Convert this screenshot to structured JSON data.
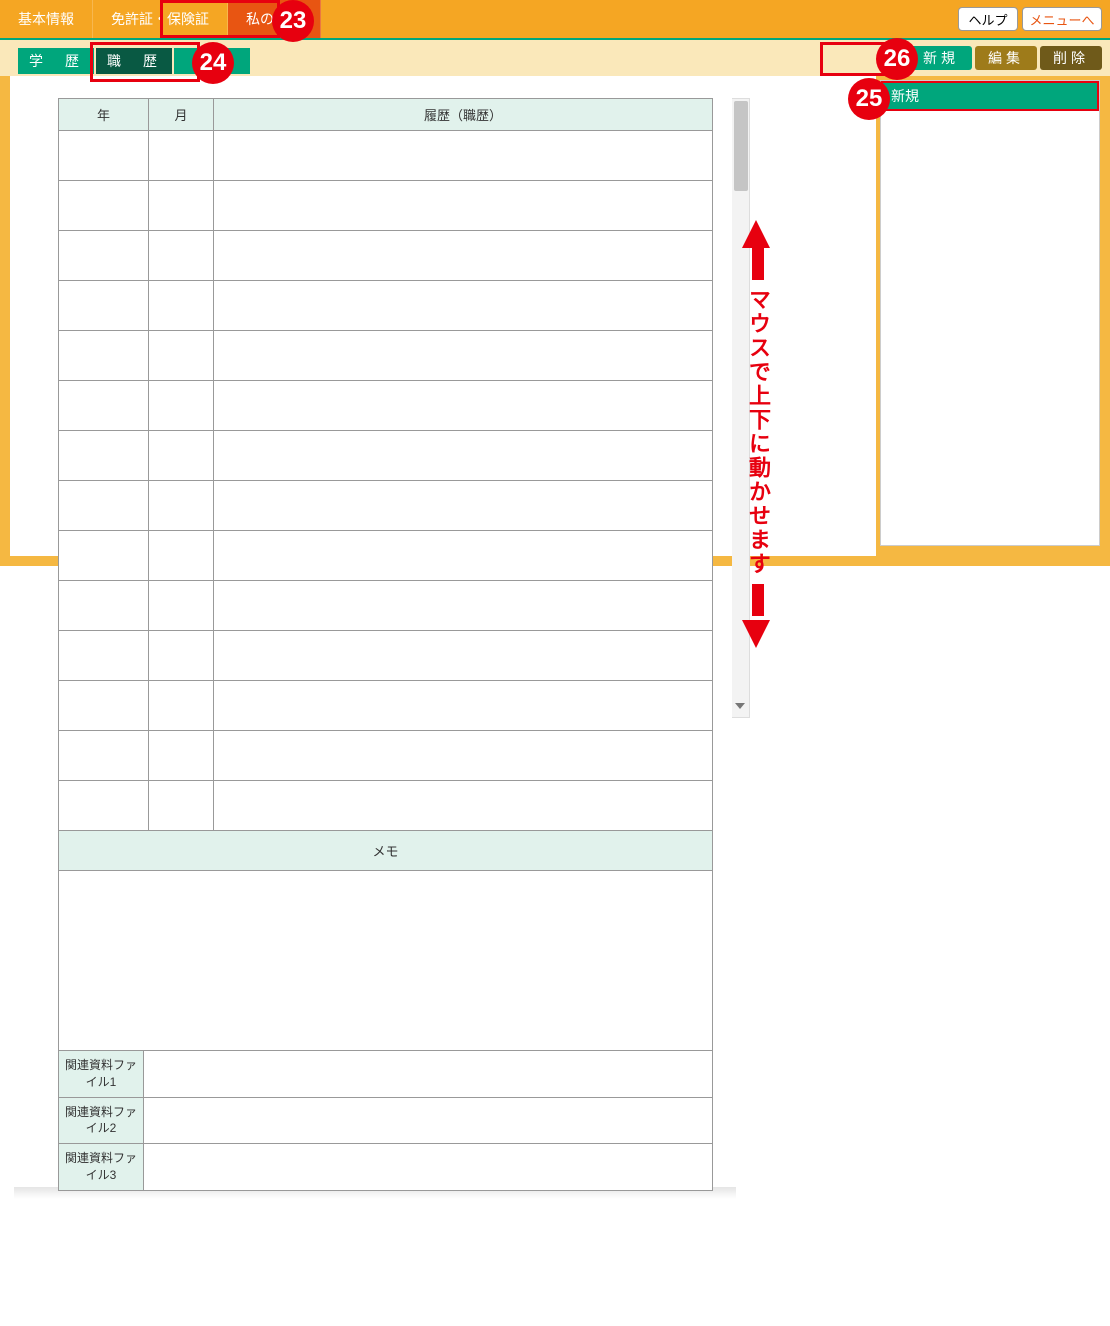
{
  "header": {
    "main_tabs": [
      "基本情報",
      "免許証・保険証",
      "私の履歴"
    ],
    "help_label": "ヘルプ",
    "menu_label": "メニューへ"
  },
  "sub_tabs": [
    "学　歴",
    "職　歴",
    "住居"
  ],
  "actions": {
    "new_label": "新規",
    "edit_label": "編集",
    "delete_label": "削除"
  },
  "side_panel": {
    "header": "新規"
  },
  "table": {
    "col_year": "年",
    "col_month": "月",
    "col_history": "履歴（職歴）"
  },
  "memo": {
    "header": "メモ"
  },
  "files": {
    "file1": "関連資料ファイル1",
    "file2": "関連資料ファイル2",
    "file3": "関連資料ファイル3"
  },
  "annotations": {
    "arrow_text": "マウスで上下に動かせます",
    "badges": {
      "b23": "23",
      "b24": "24",
      "b25": "25",
      "b26": "26"
    }
  }
}
